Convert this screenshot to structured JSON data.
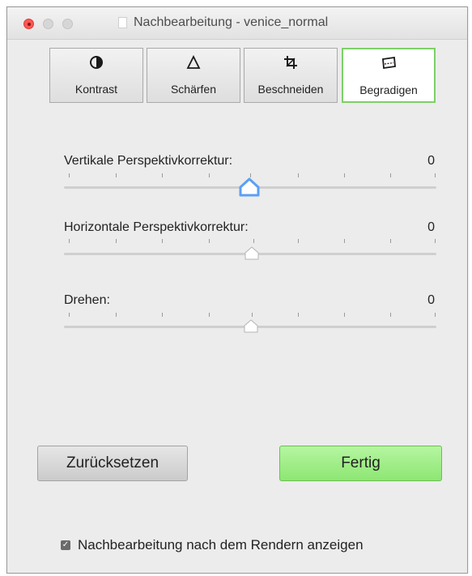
{
  "window": {
    "title": "Nachbearbeitung - venice_normal"
  },
  "tabs": [
    {
      "label": "Kontrast",
      "icon": "contrast-icon",
      "selected": false
    },
    {
      "label": "Schärfen",
      "icon": "sharpen-triangle-icon",
      "selected": false
    },
    {
      "label": "Beschneiden",
      "icon": "crop-icon",
      "selected": false
    },
    {
      "label": "Begradigen",
      "icon": "straighten-icon",
      "selected": true
    }
  ],
  "sliders": [
    {
      "label": "Vertikale Perspektivkorrektur:",
      "value": "0",
      "focused": true
    },
    {
      "label": "Horizontale Perspektivkorrektur:",
      "value": "0",
      "focused": false
    },
    {
      "label": "Drehen:",
      "value": "0",
      "focused": false
    }
  ],
  "buttons": {
    "reset_label": "Zurücksetzen",
    "done_label": "Fertig"
  },
  "option": {
    "label": "Nachbearbeitung nach dem Rendern anzeigen",
    "checked": true
  },
  "colors": {
    "selected_tab_border": "#7dd067",
    "done_button": "#9eee85",
    "focus_knob": "#5b9ff5"
  }
}
